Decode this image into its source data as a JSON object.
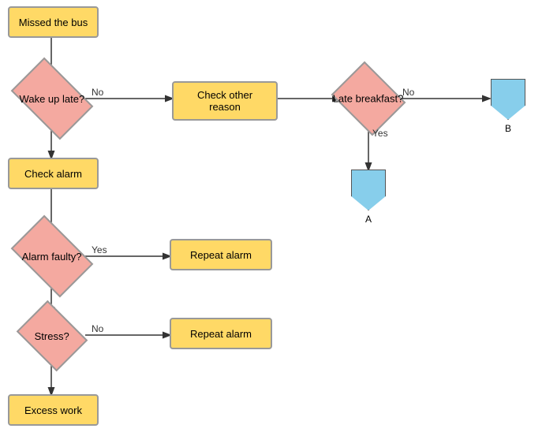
{
  "nodes": {
    "missed_bus": {
      "label": "Missed the bus"
    },
    "wake_up_late": {
      "label": "Wake up late?"
    },
    "check_other_reason": {
      "label": "Check other reason"
    },
    "late_breakfast": {
      "label": "Late breakfast?"
    },
    "check_alarm": {
      "label": "Check alarm"
    },
    "alarm_faulty": {
      "label": "Alarm faulty?"
    },
    "repeat_alarm_1": {
      "label": "Repeat alarm"
    },
    "stress": {
      "label": "Stress?"
    },
    "repeat_alarm_2": {
      "label": "Repeat alarm"
    },
    "excess_work": {
      "label": "Excess work"
    },
    "connector_a": {
      "label": "A"
    },
    "connector_b": {
      "label": "B"
    }
  },
  "edge_labels": {
    "wake_no": "No",
    "wake_yes": "",
    "late_no": "No",
    "late_yes": "Yes",
    "alarm_yes": "Yes",
    "stress_no": "No"
  }
}
